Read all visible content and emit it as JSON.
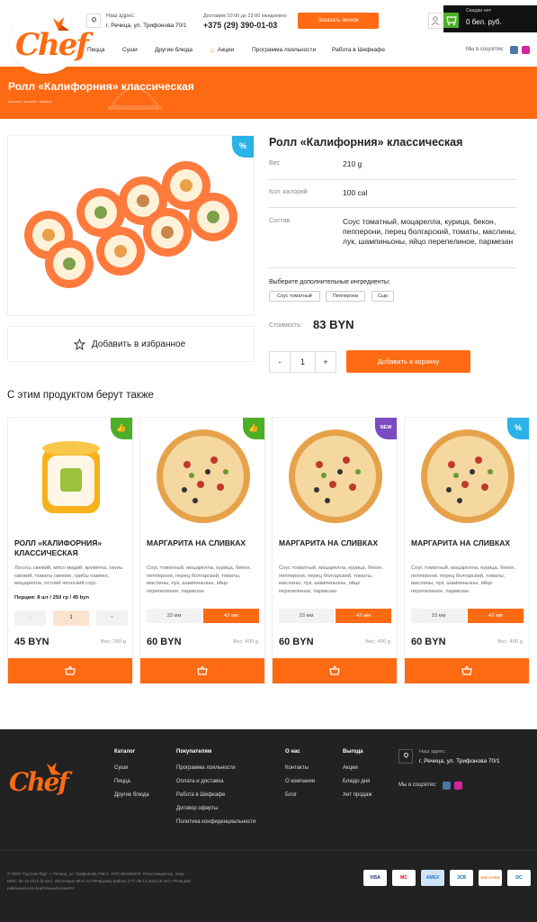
{
  "header": {
    "address_label": "Наш адрес:",
    "address": "г. Речица, ул. Трифонова 70/1",
    "hours": "Доставим 10:00 до 23:00 ежедневно",
    "phone": "+375 (29) 390-01-03",
    "call_button": "Заказать звонок",
    "cart_title": "Скидки нет",
    "cart_sum": "0 бел. руб.",
    "nav": [
      "Пицца",
      "Суши",
      "Другие блюда",
      "Акции",
      "Программа лояльности",
      "Работа в Шефкафе"
    ],
    "social_label": "Мы в соцсетях:",
    "logo_text": "Chef"
  },
  "hero": {
    "title": "Ролл «Калифорния» классическая",
    "breadcrumbs": "Крошка  •  крошка  •  крошка"
  },
  "product": {
    "title": "Ролл «Калифорния» классическая",
    "weight_label": "Вес",
    "weight": "210 g",
    "calories_label": "Кол. калорий",
    "calories": "100 cal",
    "composition_label": "Состав",
    "composition": "Соус томатный, моцарелла, курица, бекон, пепперони, перец болгарский, томаты, маслины, лук, шампиньоны, яйцо перепелиное, пармезан",
    "extras_label": "Выберите дополнительные ингредиенты:",
    "extras": [
      "Соус томатный",
      "Пепперони",
      "Сыр"
    ],
    "price_label": "Стоимость:",
    "price": "83 BYN",
    "qty_minus": "-",
    "qty": "1",
    "qty_plus": "+",
    "add_to_cart": "Добавить в корзину",
    "favorite": "Добавить в избранное"
  },
  "related": {
    "title": "С этим продуктом берут также",
    "cards": [
      {
        "name": "РОЛЛ «КАЛИФОРНИЯ» КЛАССИЧЕСКАЯ",
        "desc": "Лосось свежий, мясо мидий, креветка, окунь свежий, томаты свежие, грибы намеко, моцарелла, остовй японский соус.",
        "portion": "Порция: 8 шт / 250 гр / 45 byn",
        "minus": "-",
        "qty": "1",
        "plus": "+",
        "price": "45 BYN",
        "weight": "Вес: 250 g"
      },
      {
        "name": "МАРГАРИТА НА СЛИВКАХ",
        "desc": "Соус томатный, моцарелла, курица, бекон, пепперони, перец болгарский, томаты, маслины, лук, шампиньоны, яйцо перепелиное, пармезан",
        "size_a": "33 мм",
        "size_b": "42 мм",
        "price": "60 BYN",
        "weight": "Вес: 400 g"
      },
      {
        "name": "МАРГАРИТА НА СЛИВКАХ",
        "desc": "Соус томатный, моцарелла, курица, бекон, пепперони, перец болгарский, томаты, маслины, лук, шампиньоны, яйцо перепелиное, пармезан",
        "size_a": "33 мм",
        "size_b": "42 мм",
        "price": "60 BYN",
        "weight": "Вес: 400 g",
        "badge": "NEW"
      },
      {
        "name": "МАРГАРИТА НА СЛИВКАХ",
        "desc": "Соус томатный, моцарелла, курица, бекон, пепперони, перец болгарский, томаты, маслины, лук, шампиньоны, яйцо перепелиное, пармезан",
        "size_a": "33 мм",
        "size_b": "42 мм",
        "price": "60 BYN",
        "weight": "Вес: 400 g"
      }
    ]
  },
  "footer": {
    "catalog": {
      "title": "Каталог",
      "links": [
        "Суши",
        "Пицца",
        "Другие блюда"
      ]
    },
    "buyers": {
      "title": "Покупателям",
      "links": [
        "Программа лояльности",
        "Оплата и доставка",
        "Работа в Шефкафе",
        "Договор оферты",
        "Политика конфиденциальности"
      ]
    },
    "about": {
      "title": "О нас",
      "links": [
        "Контакты",
        "О компании",
        "Блог"
      ]
    },
    "deals": {
      "title": "Выгода",
      "links": [
        "Акции",
        "Блюдо дня",
        "Хит продаж"
      ]
    },
    "address_label": "Наш адрес:",
    "address": "г. Речица, ул. Трифонова 70/1",
    "social_label": "Мы в соцсетях:",
    "legal": "© ООО \"Гуд Кэм Фуд\". г. Речица, ул. Трифонова 70В-1. УНП 491160978. Регистрация юр. лица МНС: 06.12.2013 (5 лет). Инспекция МНС по Речицкому району 17Т: 05.12.2013 (5 лет). Речицкий районный исполнительный комитет",
    "payments": [
      "VISA",
      "MC",
      "AMEX",
      "JCB",
      "DISCOVER",
      "DC"
    ]
  },
  "colors": {
    "accent": "#ff6a13",
    "green": "#4caf27",
    "purple": "#7b4bc4",
    "blue": "#2bb2e6",
    "footer": "#222222"
  }
}
